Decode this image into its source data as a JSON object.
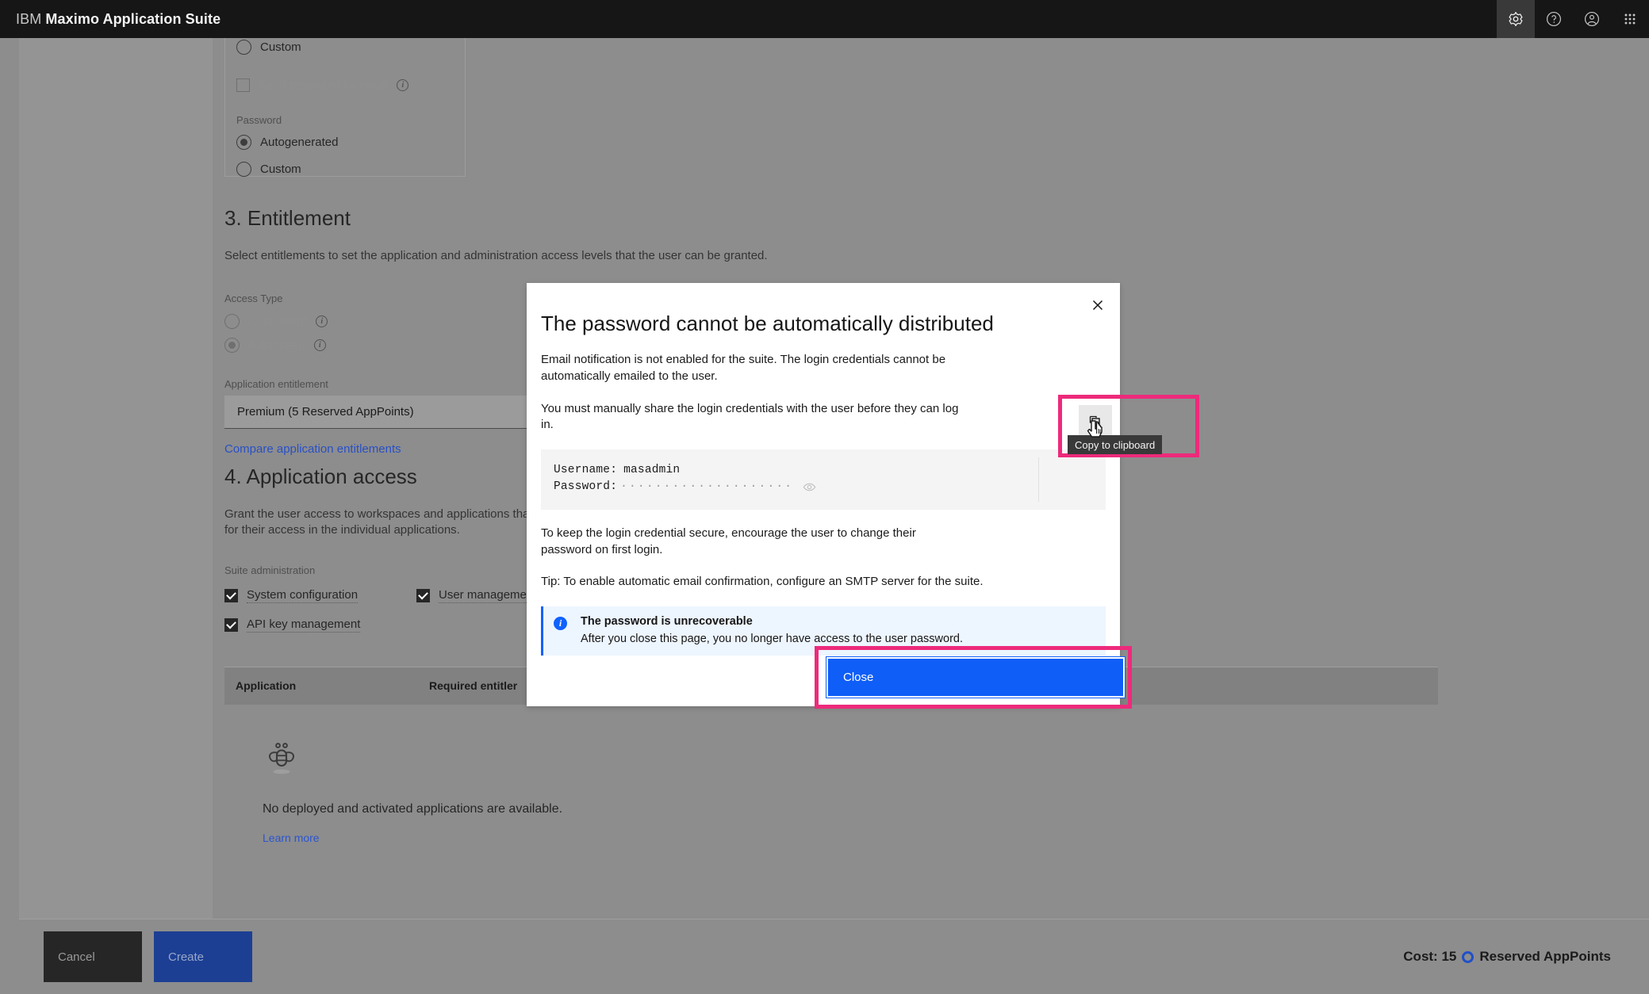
{
  "header": {
    "title_prefix": "IBM",
    "title_main": "Maximo Application Suite",
    "icons": [
      {
        "name": "gear-icon",
        "label": "Administration"
      },
      {
        "name": "help-icon",
        "label": "Help"
      },
      {
        "name": "user-avatar-icon",
        "label": "Profile"
      },
      {
        "name": "app-switcher-icon",
        "label": "Switch application"
      }
    ]
  },
  "form": {
    "credentials_card": {
      "top_option": "Custom",
      "send_password_by_email": "Send password by email",
      "password_label": "Password",
      "options": [
        "Autogenerated",
        "Custom"
      ],
      "selected_option": "Autogenerated"
    },
    "section3": {
      "title": "3. Entitlement",
      "description": "Select entitlements to set the application and administration access levels that the user can be granted.",
      "access_type_label": "Access Type",
      "access_types": [
        "Concurrent",
        "Authorized"
      ],
      "access_type_selected": "Authorized",
      "app_entitlement_label": "Application entitlement",
      "app_entitlement_value": "Premium (5 Reserved AppPoints)",
      "compare_link": "Compare application entitlements"
    },
    "section4": {
      "title": "4. Application access",
      "description_line1": "Grant the user access to workspaces and applications that t",
      "description_line2": "for their access in the individual applications.",
      "suite_admin_label": "Suite administration",
      "checkboxes": [
        {
          "label": "System configuration",
          "checked": true
        },
        {
          "label": "User management",
          "checked": true
        },
        {
          "label": "API key management",
          "checked": true
        }
      ],
      "table": {
        "columns": [
          "Application",
          "Required entitler"
        ],
        "empty_text": "No deployed and activated applications are available.",
        "empty_link": "Learn more"
      }
    }
  },
  "footer": {
    "cancel_label": "Cancel",
    "create_label": "Create",
    "cost_prefix": "Cost: 15",
    "cost_suffix": "Reserved AppPoints"
  },
  "modal": {
    "title": "The password cannot be automatically distributed",
    "paragraph1": "Email notification is not enabled for the suite. The login credentials cannot be automatically emailed to the user.",
    "paragraph2": "You must manually share the login credentials with the user before they can log in.",
    "credentials": {
      "username_label": "Username:",
      "username_value": "masadmin",
      "password_label": "Password:",
      "password_masked": "····················",
      "eye_icon": "view-icon",
      "copy_button_name": "copy-to-clipboard-button",
      "copy_tooltip": "Copy to clipboard"
    },
    "paragraph3": "To keep the login credential secure, encourage the user to change their password on first login.",
    "paragraph4": "Tip: To enable automatic email confirmation, configure an SMTP server for the suite.",
    "notification": {
      "title": "The password is unrecoverable",
      "subtitle": "After you close this page, you no longer have access to the user password."
    },
    "close_button": "Close",
    "close_x_icon": "close-icon"
  },
  "colors": {
    "header_bg": "#161616",
    "accent_blue": "#0f62fe",
    "close_button_blue": "#0f5ef7",
    "highlight_pink": "#ed2a7b",
    "notification_bg": "#edf5ff",
    "scrim_gray": "#8d8d8d"
  }
}
